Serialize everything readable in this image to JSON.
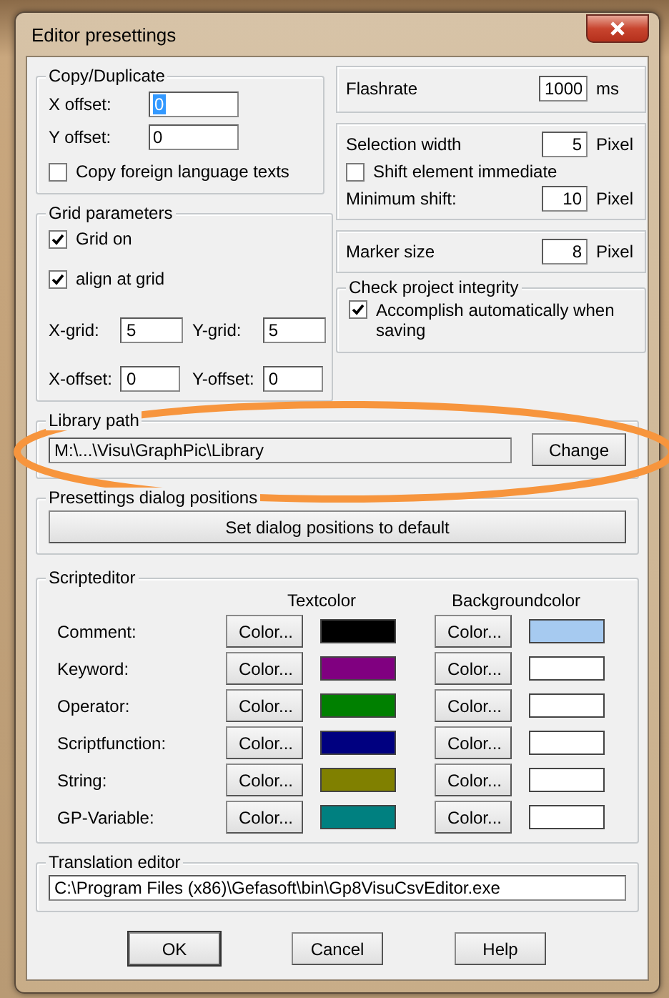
{
  "window": {
    "title": "Editor presettings"
  },
  "copy_duplicate": {
    "title": "Copy/Duplicate",
    "fields": [
      {
        "label": "X offset:",
        "value": "0",
        "selected": true
      },
      {
        "label": "Y offset:",
        "value": "0",
        "selected": false
      }
    ],
    "checkbox": {
      "label": "Copy foreign language texts",
      "checked": false
    }
  },
  "grid": {
    "title": "Grid parameters",
    "checkboxes": [
      {
        "label": "Grid on",
        "checked": true
      },
      {
        "label": "align at grid",
        "checked": true
      }
    ],
    "fields": [
      {
        "label": "X-grid:",
        "value": "5"
      },
      {
        "label": "Y-grid:",
        "value": "5"
      },
      {
        "label": "X-offset:",
        "value": "0"
      },
      {
        "label": "Y-offset:",
        "value": "0"
      }
    ]
  },
  "flashrate": {
    "label": "Flashrate",
    "value": "1000",
    "unit": "ms"
  },
  "selection": {
    "width": {
      "label": "Selection width",
      "value": "5",
      "unit": "Pixel"
    },
    "checkbox": {
      "label": "Shift element immediate",
      "checked": false
    },
    "min_shift": {
      "label": "Minimum shift:",
      "value": "10",
      "unit": "Pixel"
    }
  },
  "marker": {
    "label": "Marker size",
    "value": "8",
    "unit": "Pixel"
  },
  "integrity": {
    "title": "Check project integrity",
    "checkbox": {
      "label": "Accomplish automatically when saving",
      "checked": true
    }
  },
  "library": {
    "title": "Library path",
    "value": "M:\\...\\Visu\\GraphPic\\Library",
    "button": "Change"
  },
  "dialog_positions": {
    "title": "Presettings dialog positions",
    "button": "Set dialog positions to default"
  },
  "script_editor": {
    "title": "Scripteditor",
    "columns": [
      "Textcolor",
      "Backgroundcolor"
    ],
    "rows": [
      {
        "label": "Comment:",
        "text_button": "Color...",
        "text_swatch": {
          "color": "#000000"
        },
        "bg_button": "Color...",
        "bg_swatch": {
          "color": "#a6caf0"
        }
      },
      {
        "label": "Keyword:",
        "text_button": "Color...",
        "text_swatch": {
          "color": "#800080"
        },
        "bg_button": "Color...",
        "bg_swatch": {
          "color": "#ffffff"
        }
      },
      {
        "label": "Operator:",
        "text_button": "Color...",
        "text_swatch": {
          "color": "#008000"
        },
        "bg_button": "Color...",
        "bg_swatch": {
          "color": "#ffffff"
        }
      },
      {
        "label": "Scriptfunction:",
        "text_button": "Color...",
        "text_swatch": {
          "color": "#000080"
        },
        "bg_button": "Color...",
        "bg_swatch": {
          "color": "#ffffff"
        }
      },
      {
        "label": "String:",
        "text_button": "Color...",
        "text_swatch": {
          "color": "#808000"
        },
        "bg_button": "Color...",
        "bg_swatch": {
          "color": "#ffffff"
        }
      },
      {
        "label": "GP-Variable:",
        "text_button": "Color...",
        "text_swatch": {
          "color": "#008080"
        },
        "bg_button": "Color...",
        "bg_swatch": {
          "color": "#ffffff"
        }
      }
    ]
  },
  "translation": {
    "title": "Translation editor",
    "value": "C:\\Program Files (x86)\\Gefasoft\\bin\\Gp8VisuCsvEditor.exe"
  },
  "buttons": [
    {
      "label": "OK",
      "default": true
    },
    {
      "label": "Cancel",
      "default": false
    },
    {
      "label": "Help",
      "default": false
    }
  ]
}
